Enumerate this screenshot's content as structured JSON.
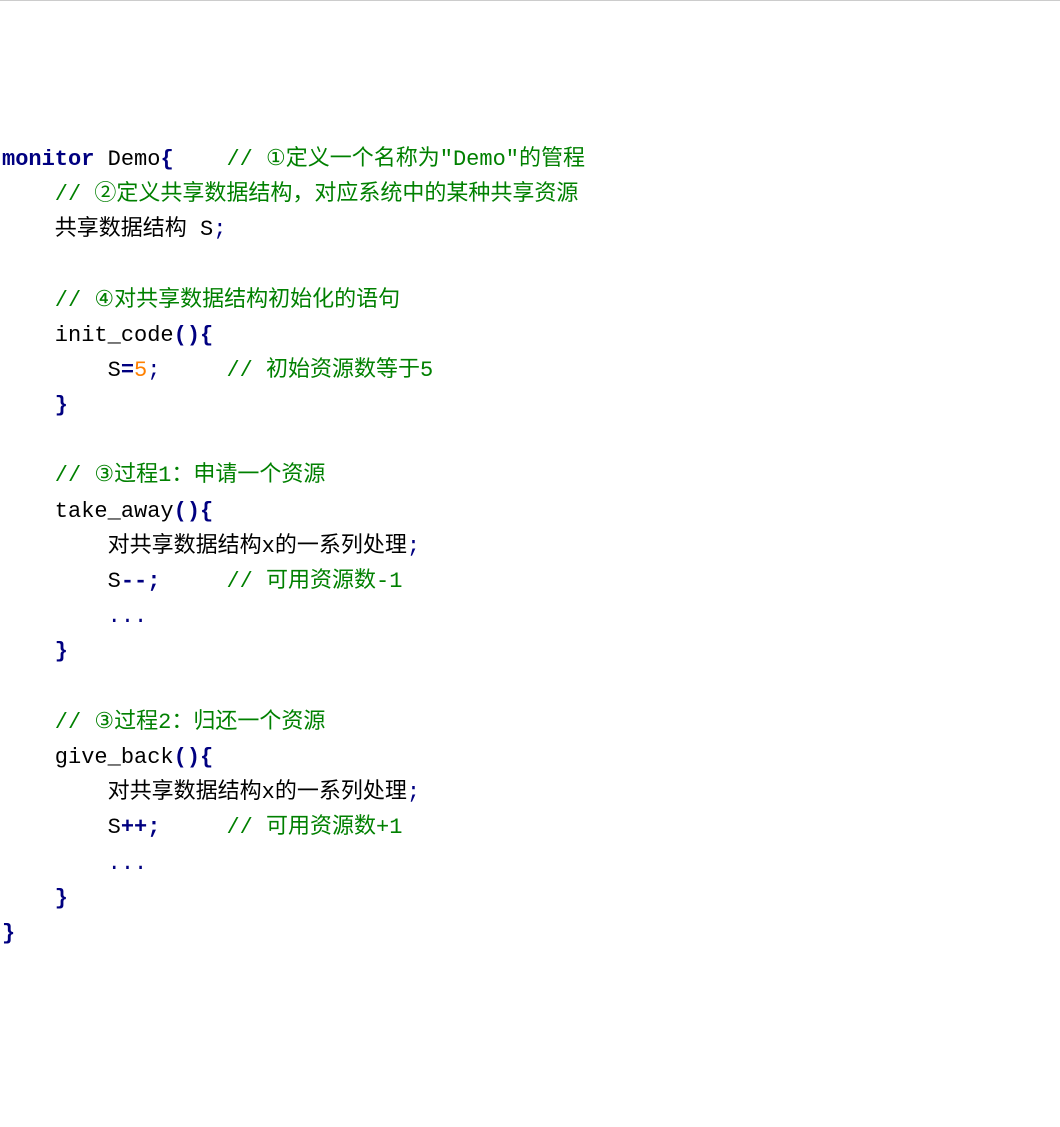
{
  "code": {
    "line1_kw1": "monitor",
    "line1_id": " Demo",
    "line1_brace": "{",
    "line1_cm": "    // ①定义一个名称为\"Demo\"的管程",
    "line2_cm": "    // ②定义共享数据结构，对应系统中的某种共享资源",
    "line3_txt": "    共享数据结构 S",
    "line3_semi": ";",
    "blank1": "",
    "line5_cm": "    // ④对共享数据结构初始化的语句",
    "line6_fn": "    init_code",
    "line6_paren": "()",
    "line6_brace": "{",
    "line7_s": "        S",
    "line7_eq": "=",
    "line7_num": "5",
    "line7_semi": ";",
    "line7_cm": "     // 初始资源数等于5",
    "line8_brace": "    }",
    "blank2": "",
    "line10_cm": "    // ③过程1：申请一个资源",
    "line11_fn": "    take_away",
    "line11_paren": "()",
    "line11_brace": "{",
    "line12_txt": "        对共享数据结构x的一系列处理",
    "line12_semi": ";",
    "line13_s": "        S",
    "line13_op": "--;",
    "line13_cm": "     // 可用资源数-1",
    "line14_dots": "        ...",
    "line15_brace": "    }",
    "blank3": "",
    "line17_cm": "    // ③过程2：归还一个资源",
    "line18_fn": "    give_back",
    "line18_paren": "()",
    "line18_brace": "{",
    "line19_txt": "        对共享数据结构x的一系列处理",
    "line19_semi": ";",
    "line20_s": "        S",
    "line20_op": "++;",
    "line20_cm": "     // 可用资源数+1",
    "line21_dots": "        ...",
    "line22_brace": "    }",
    "line23_brace": "}"
  }
}
